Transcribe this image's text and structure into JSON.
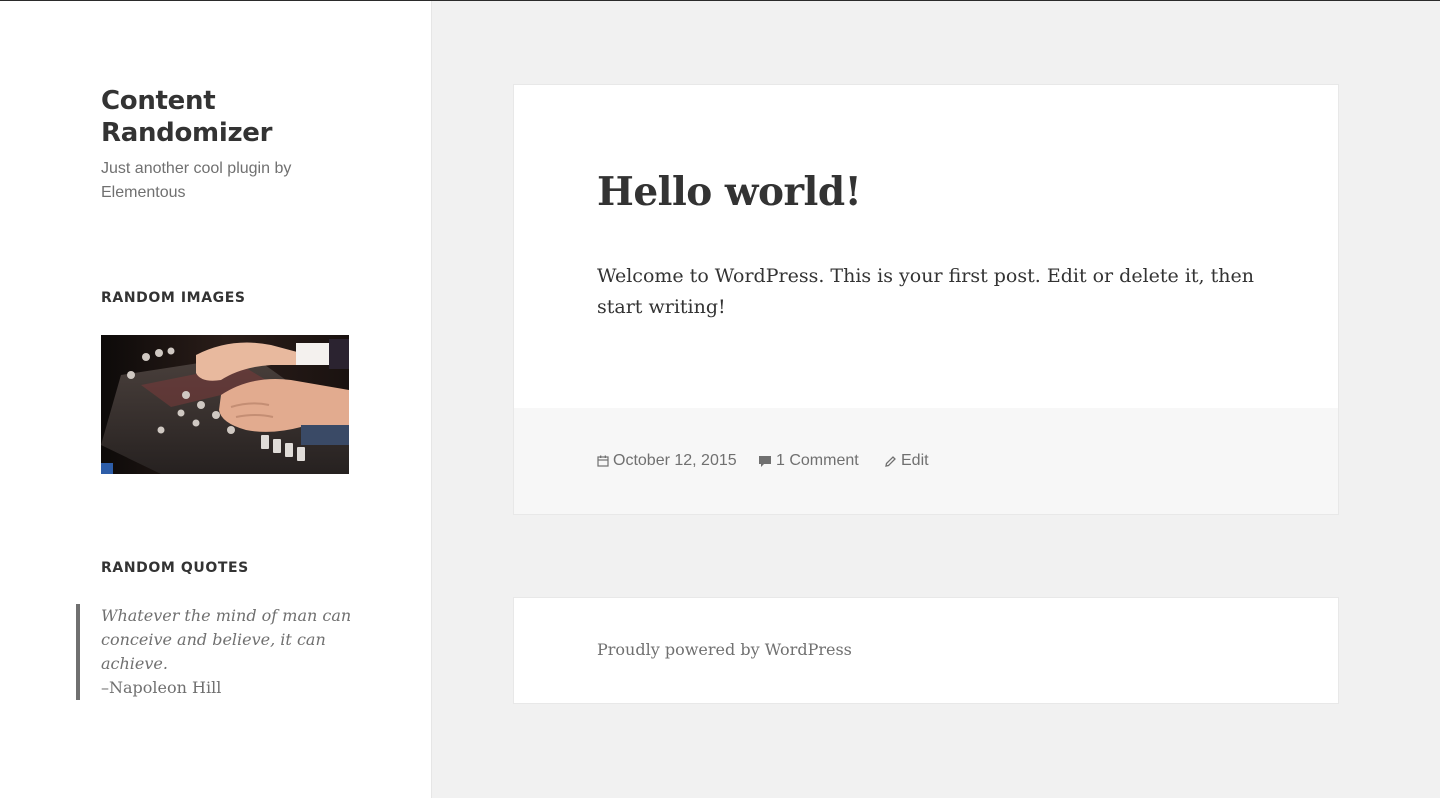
{
  "site": {
    "title": "Content Randomizer",
    "description": "Just another cool plugin by Elementous"
  },
  "widgets": {
    "images": {
      "title": "RANDOM IMAGES",
      "image_icon": "mixing-console-photo"
    },
    "quotes": {
      "title": "RANDOM QUOTES",
      "text": "Whatever the mind of man can conceive and believe, it can achieve.",
      "author": "–Napoleon Hill"
    }
  },
  "post": {
    "title": "Hello world!",
    "content": "Welcome to WordPress. This is your first post. Edit or delete it, then start writing!",
    "meta": {
      "date": "October 12, 2015",
      "date_icon": "calendar-icon",
      "comments": "1 Comment",
      "comments_icon": "comment-icon",
      "edit": "Edit",
      "edit_icon": "pencil-icon"
    }
  },
  "footer": {
    "powered_by": "Proudly powered by WordPress"
  },
  "colors": {
    "background": "#f1f1f1",
    "sidebar": "#ffffff",
    "text": "#333333",
    "muted": "#707070",
    "post_footer": "#f7f7f7"
  }
}
